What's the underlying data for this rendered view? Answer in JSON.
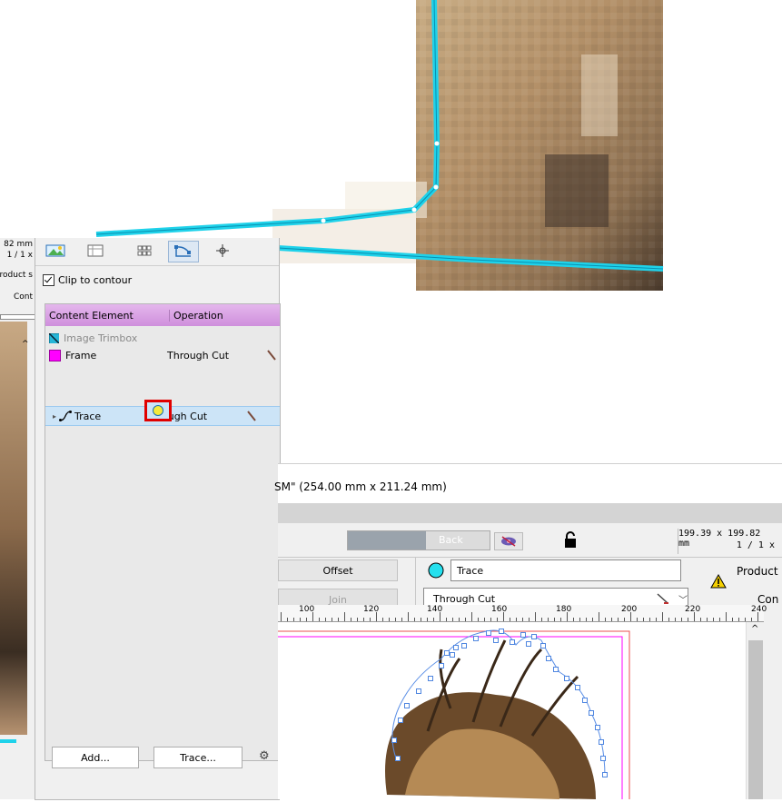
{
  "panel": {
    "clip_label": "Clip to contour",
    "table": {
      "col_content": "Content Element",
      "col_operation": "Operation",
      "rows": [
        {
          "name": "Image Trimbox",
          "operation": ""
        },
        {
          "name": "Frame",
          "operation": "Through Cut"
        },
        {
          "name": "Trace",
          "operation": "Through Cut"
        }
      ]
    },
    "add_button": "Add...",
    "trace_button": "Trace..."
  },
  "left_sliver": {
    "size": "82 mm",
    "scale": "1 / 1 x",
    "product": "roduct s",
    "cont": "Cont"
  },
  "main": {
    "title": "SM\" (254.00 mm x 211.24 mm)",
    "back_button": "Back",
    "dimensions": "199.39 x 199.82 mm",
    "scale": "1 / 1 x",
    "offset_button": "Offset",
    "join_button": "Join",
    "element_name": "Trace",
    "operation_select": "Through Cut",
    "product_label": "Product",
    "cont_label": "Con",
    "ruler_labels": [
      "100",
      "120",
      "140",
      "160",
      "180",
      "200",
      "220",
      "240"
    ]
  },
  "colors": {
    "trace": "#1fd2ea",
    "frame": "#ff00ff",
    "header": "#d89ae3",
    "selected_row": "#cce4f7",
    "highlight_box": "#e00000"
  }
}
